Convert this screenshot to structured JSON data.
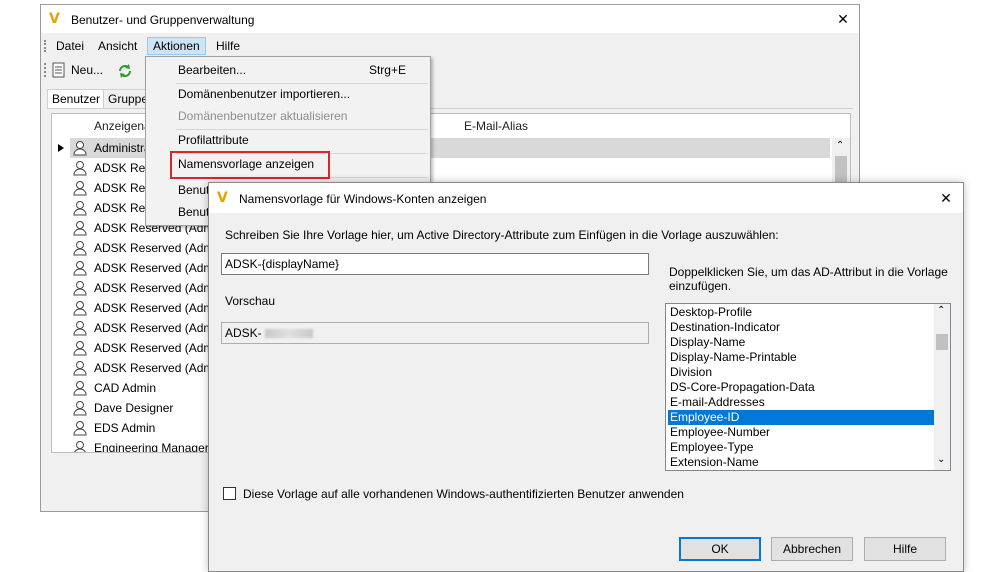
{
  "main_window": {
    "title": "Benutzer- und Gruppenverwaltung",
    "menu": [
      "Datei",
      "Ansicht",
      "Aktionen",
      "Hilfe"
    ],
    "toolbar": {
      "new_label": "Neu..."
    },
    "tabs": [
      "Benutzer",
      "Gruppe"
    ],
    "columns": {
      "display_name": "Anzeigena",
      "email_alias": "E-Mail-Alias"
    },
    "rows": [
      "Administra",
      "ADSK Reser",
      "ADSK Reser",
      "ADSK Rese",
      "ADSK Reserved (Admi",
      "ADSK Reserved (Admi",
      "ADSK Reserved (Admi",
      "ADSK Reserved (Admi",
      "ADSK Reserved (Admi",
      "ADSK Reserved (Admi",
      "ADSK Reserved (Admi",
      "ADSK Reserved (Admi",
      "CAD Admin",
      "Dave Designer",
      "EDS Admin",
      "Engineering Manager"
    ]
  },
  "dropdown": {
    "items": [
      {
        "label": "Bearbeiten...",
        "shortcut": "Strg+E"
      },
      {
        "label": "Domänenbenutzer importieren..."
      },
      {
        "label": "Domänenbenutzer aktualisieren"
      },
      {
        "label": "Profilattribute"
      },
      {
        "label": "Namensvorlage anzeigen"
      },
      {
        "label": "Benut"
      },
      {
        "label": "Benut"
      }
    ]
  },
  "dialog": {
    "title": "Namensvorlage für Windows-Konten anzeigen",
    "instruction": "Schreiben Sie Ihre Vorlage hier, um Active Directory-Attribute zum Einfügen in die Vorlage auszuwählen:",
    "template_value": "ADSK-{displayName}",
    "preview_label": "Vorschau",
    "preview_value": "ADSK-",
    "hint": "Doppelklicken Sie, um das AD-Attribut in die Vorlage einzufügen.",
    "attributes": [
      "Desktop-Profile",
      "Destination-Indicator",
      "Display-Name",
      "Display-Name-Printable",
      "Division",
      "DS-Core-Propagation-Data",
      "E-mail-Addresses",
      "Employee-ID",
      "Employee-Number",
      "Employee-Type",
      "Extension-Name"
    ],
    "selected_attribute": "Employee-ID",
    "checkbox_label": "Diese Vorlage auf alle vorhandenen Windows-authentifizierten Benutzer anwenden",
    "buttons": {
      "ok": "OK",
      "cancel": "Abbrechen",
      "help": "Hilfe"
    }
  },
  "colors": {
    "accent": "#0078d7",
    "highlight": "#d9262b",
    "logo": "#e8a200"
  }
}
